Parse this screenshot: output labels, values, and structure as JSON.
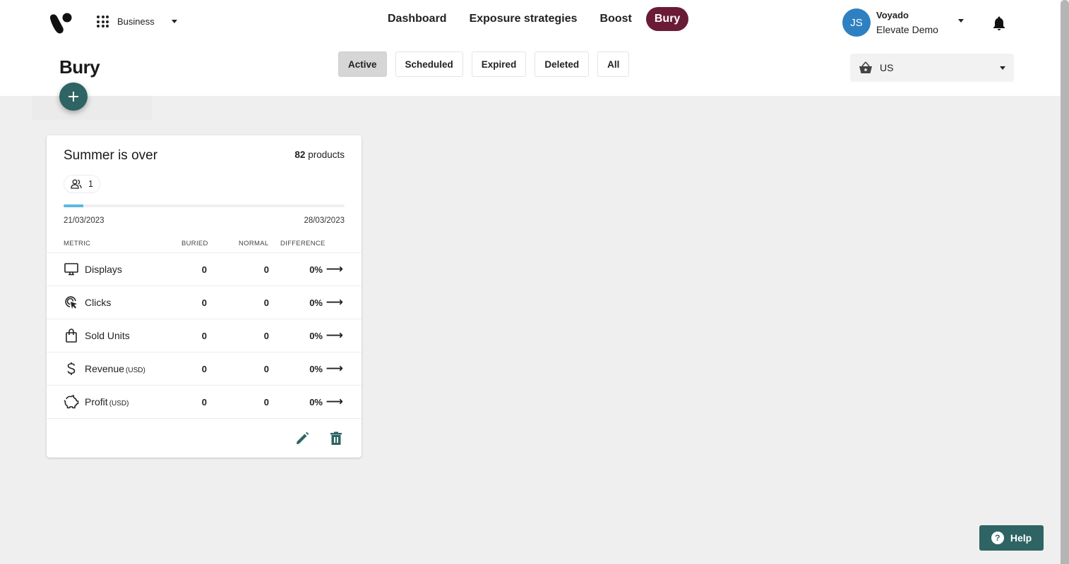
{
  "app": {
    "switcher_label": "Business",
    "brand_color": "#6a1b35",
    "accent_color": "#2e6463"
  },
  "nav": {
    "items": [
      {
        "label": "Dashboard",
        "active": false
      },
      {
        "label": "Exposure strategies",
        "active": false
      },
      {
        "label": "Boost",
        "active": false
      },
      {
        "label": "Bury",
        "active": true
      }
    ]
  },
  "user": {
    "initials": "JS",
    "organization": "Voyado",
    "account": "Elevate Demo"
  },
  "page": {
    "title": "Bury",
    "add_button_symbol": "+"
  },
  "filters": {
    "items": [
      {
        "label": "Active",
        "active": true
      },
      {
        "label": "Scheduled",
        "active": false
      },
      {
        "label": "Expired",
        "active": false
      },
      {
        "label": "Deleted",
        "active": false
      },
      {
        "label": "All",
        "active": false
      }
    ]
  },
  "market_selector": {
    "value": "US"
  },
  "campaign": {
    "title": "Summer is over",
    "product_count": "82",
    "product_label": "products",
    "audience_count": "1",
    "progress_fraction": 0.07,
    "start_date": "21/03/2023",
    "end_date": "28/03/2023",
    "columns": {
      "metric": "METRIC",
      "buried": "BURIED",
      "normal": "NORMAL",
      "difference": "DIFFERENCE"
    },
    "metrics": [
      {
        "icon": "monitor-icon",
        "name": "Displays",
        "unit": "",
        "buried": "0",
        "normal": "0",
        "difference": "0%",
        "arrow": "⟶"
      },
      {
        "icon": "click-icon",
        "name": "Clicks",
        "unit": "",
        "buried": "0",
        "normal": "0",
        "difference": "0%",
        "arrow": "⟶"
      },
      {
        "icon": "shopping-bag-icon",
        "name": "Sold Units",
        "unit": "",
        "buried": "0",
        "normal": "0",
        "difference": "0%",
        "arrow": "⟶"
      },
      {
        "icon": "dollar-icon",
        "name": "Revenue",
        "unit": "(USD)",
        "buried": "0",
        "normal": "0",
        "difference": "0%",
        "arrow": "⟶"
      },
      {
        "icon": "piggy-bank-icon",
        "name": "Profit",
        "unit": "(USD)",
        "buried": "0",
        "normal": "0",
        "difference": "0%",
        "arrow": "⟶"
      }
    ]
  },
  "help": {
    "label": "Help",
    "symbol": "?"
  }
}
